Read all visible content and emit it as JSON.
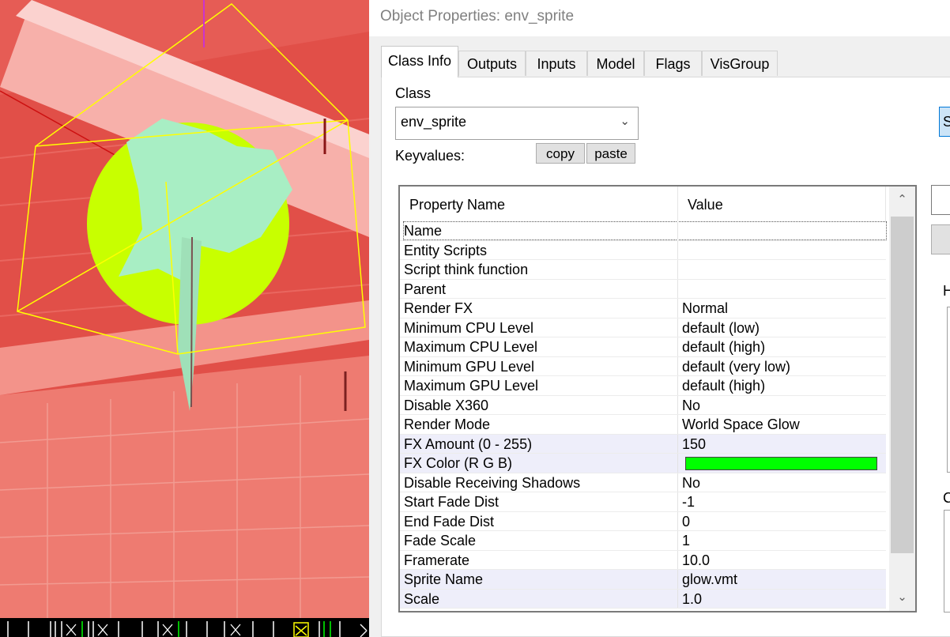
{
  "dialog": {
    "title": "Object Properties: env_sprite",
    "tabs": [
      "Class Info",
      "Outputs",
      "Inputs",
      "Model",
      "Flags",
      "VisGroup"
    ],
    "active_tab": "Class Info",
    "class_label": "Class",
    "class_value": "env_sprite",
    "keyvalues_label": "Keyvalues:",
    "copy_label": "copy",
    "paste_label": "paste",
    "grid": {
      "headers": [
        "Property Name",
        "Value"
      ],
      "rows": [
        {
          "name": "Name",
          "value": ""
        },
        {
          "name": "Entity Scripts",
          "value": ""
        },
        {
          "name": "Script think function",
          "value": ""
        },
        {
          "name": "Parent",
          "value": ""
        },
        {
          "name": "Render FX",
          "value": "Normal"
        },
        {
          "name": "Minimum CPU Level",
          "value": "default (low)"
        },
        {
          "name": "Maximum CPU Level",
          "value": "default (high)"
        },
        {
          "name": "Minimum GPU Level",
          "value": "default (very low)"
        },
        {
          "name": "Maximum GPU Level",
          "value": "default (high)"
        },
        {
          "name": "Disable X360",
          "value": "No"
        },
        {
          "name": "Render Mode",
          "value": "World Space Glow"
        },
        {
          "name": "FX Amount (0 - 255)",
          "value": "150"
        },
        {
          "name": "FX Color (R G B)",
          "value": ""
        },
        {
          "name": "Disable Receiving Shadows",
          "value": "No"
        },
        {
          "name": "Start Fade Dist",
          "value": "-1"
        },
        {
          "name": "End Fade Dist",
          "value": "0"
        },
        {
          "name": "Fade Scale",
          "value": "1"
        },
        {
          "name": "Framerate",
          "value": "10.0"
        },
        {
          "name": "Sprite Name",
          "value": "glow.vmt"
        },
        {
          "name": "Scale",
          "value": "1.0"
        }
      ],
      "highlighted_rows": [
        11,
        12,
        18,
        19
      ],
      "fx_color_swatch": "#00ff00"
    },
    "right_edge": {
      "button_initial": "S",
      "label_h": "H",
      "label_c": "C"
    }
  },
  "viewport": {
    "background_color": "#e85a52",
    "glow_color": "#c8ff00",
    "bbox_color": "#ffff00"
  }
}
